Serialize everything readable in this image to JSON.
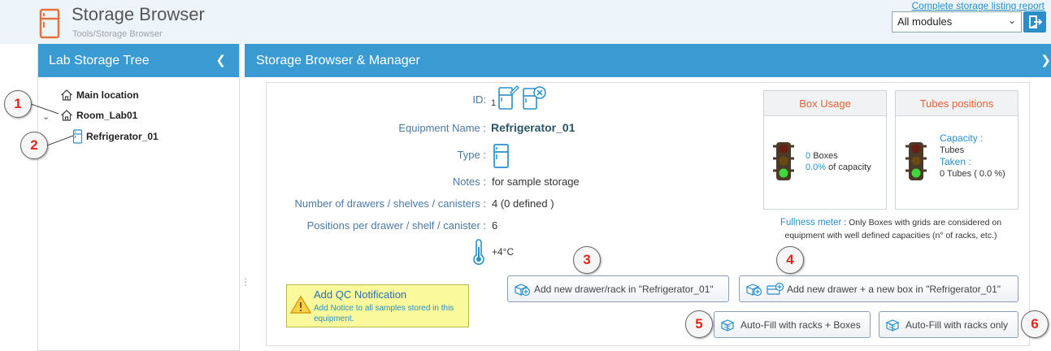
{
  "header": {
    "title": "Storage Browser",
    "breadcrumb": "Tools/Storage Browser",
    "report_link": "Complete storage listing report",
    "module_select": "All modules",
    "logo_icon": "fridge-icon",
    "export_icon": "export-icon"
  },
  "left_panel": {
    "title": "Lab Storage Tree",
    "collapse_icon": "chevron-left-icon",
    "tree": [
      {
        "label": "Main location",
        "icon": "home-icon"
      },
      {
        "label": "Room_Lab01",
        "icon": "home-icon",
        "expanded": true
      },
      {
        "label": "Refrigerator_01",
        "icon": "fridge-icon"
      }
    ]
  },
  "right_panel": {
    "title": "Storage Browser & Manager"
  },
  "details": {
    "id_label": "ID:",
    "id_value": "1",
    "equipment_name_label": "Equipment Name :",
    "equipment_name": "Refrigerator_01",
    "type_label": "Type :",
    "notes_label": "Notes :",
    "notes": "for sample storage",
    "drawers_label": "Number of drawers / shelves / canisters :",
    "drawers_value": "4 (0 defined )",
    "positions_label": "Positions per drawer / shelf / canister :",
    "positions_value": "6",
    "temperature": "+4°C"
  },
  "box_usage": {
    "title": "Box Usage",
    "boxes_count": "0",
    "boxes_label": "Boxes",
    "capacity_pct": "0.0%",
    "capacity_label": "of capacity",
    "traffic_light": "green"
  },
  "tubes_positions": {
    "title": "Tubes positions",
    "capacity_label": "Capacity :",
    "capacity_value": "Tubes",
    "taken_label": "Taken :",
    "taken_value": "0 Tubes ( 0.0 %)",
    "traffic_light": "green"
  },
  "fullness": {
    "label": "Fullness meter",
    "text": ": Only Boxes with grids are considered on equipment with well defined capacities (n° of racks, etc.)"
  },
  "buttons": {
    "add_drawer": "Add new drawer/rack in \"Refrigerator_01\"",
    "add_drawer_box": "Add new drawer + a new box in \"Refrigerator_01\"",
    "autofill_boxes": "Auto-Fill with racks + Boxes",
    "autofill_racks": "Auto-Fill with racks only"
  },
  "qc": {
    "title": "Add QC Notification",
    "description": "Add Notice to all samples stored in this equipment."
  },
  "annotations": [
    "1",
    "2",
    "3",
    "4",
    "5",
    "6"
  ],
  "colors": {
    "accent": "#3a9bd2",
    "link": "#2a8fc7",
    "card_title": "#e0623a",
    "badge_number": "#e0271a",
    "qc_background": "#fafa9c"
  }
}
